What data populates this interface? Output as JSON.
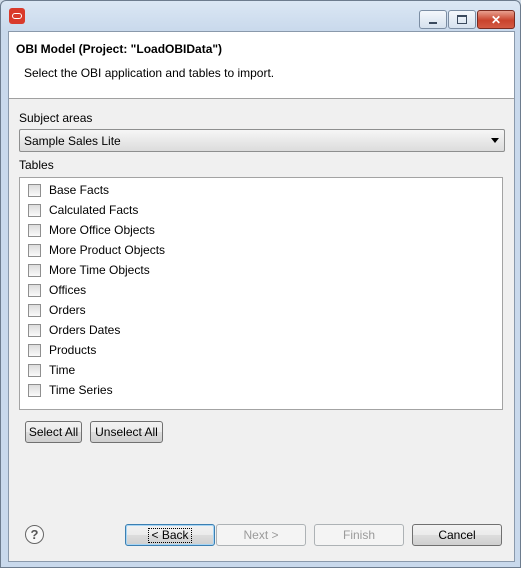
{
  "window": {
    "controls": {
      "minimize": "",
      "maximize": "",
      "close": "✕"
    }
  },
  "header": {
    "title": "OBI Model (Project: \"LoadOBIData\")",
    "description": "Select the OBI application and tables to import."
  },
  "subject_areas": {
    "label": "Subject areas",
    "selected": "Sample Sales Lite"
  },
  "tables": {
    "label": "Tables",
    "items": [
      {
        "label": "Base Facts",
        "checked": false
      },
      {
        "label": "Calculated Facts",
        "checked": false
      },
      {
        "label": "More Office Objects",
        "checked": false
      },
      {
        "label": "More Product Objects",
        "checked": false
      },
      {
        "label": "More Time Objects",
        "checked": false
      },
      {
        "label": "Offices",
        "checked": false
      },
      {
        "label": "Orders",
        "checked": false
      },
      {
        "label": "Orders Dates",
        "checked": false
      },
      {
        "label": "Products",
        "checked": false
      },
      {
        "label": "Time",
        "checked": false
      },
      {
        "label": "Time Series",
        "checked": false
      }
    ]
  },
  "selection_buttons": {
    "select_all": "Select All",
    "unselect_all": "Unselect All"
  },
  "footer": {
    "help": "?",
    "back": "< Back",
    "next": "Next >",
    "finish": "Finish",
    "cancel": "Cancel"
  }
}
